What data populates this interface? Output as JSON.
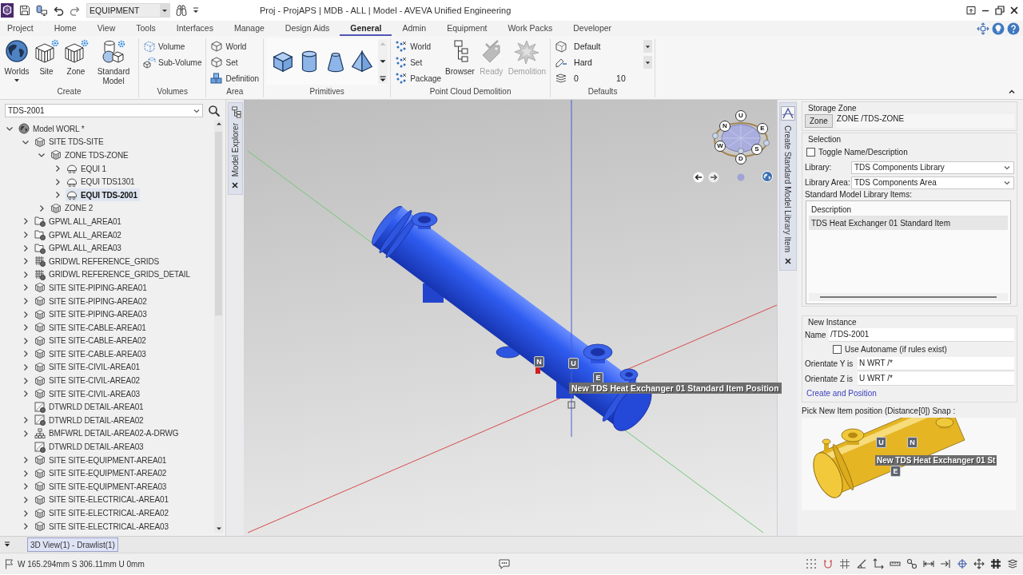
{
  "title_bar": {
    "quick_access_value": "EQUIPMENT",
    "title": "Proj - ProjAPS | MDB - ALL | Model - AVEVA Unified Engineering"
  },
  "ribbon": {
    "tabs": [
      {
        "label": "Project",
        "selected": false
      },
      {
        "label": "Home",
        "selected": false
      },
      {
        "label": "View",
        "selected": false
      },
      {
        "label": "Tools",
        "selected": false
      },
      {
        "label": "Interfaces",
        "selected": false
      },
      {
        "label": "Manage",
        "selected": false
      },
      {
        "label": "Design Aids",
        "selected": false
      },
      {
        "label": "General",
        "selected": true
      },
      {
        "label": "Admin",
        "selected": false
      },
      {
        "label": "Equipment",
        "selected": false
      },
      {
        "label": "Work Packs",
        "selected": false
      },
      {
        "label": "Developer",
        "selected": false
      }
    ],
    "groups": [
      {
        "label": "Create",
        "kind": "buttons",
        "items": [
          {
            "kind": "large",
            "label": "Worlds",
            "menu": true
          },
          {
            "kind": "large",
            "label": "Site",
            "menu": false
          },
          {
            "kind": "large",
            "label": "Zone",
            "menu": false
          },
          {
            "kind": "large",
            "label": "Standard Model",
            "menu": false
          }
        ]
      },
      {
        "label": "Volumes",
        "kind": "buttons",
        "items": [
          {
            "kind": "small",
            "label": "Volume"
          },
          {
            "kind": "small",
            "label": "Sub-Volume"
          }
        ]
      },
      {
        "label": "Area",
        "kind": "buttons",
        "items": [
          {
            "kind": "small",
            "label": "World"
          },
          {
            "kind": "small",
            "label": "Set"
          },
          {
            "kind": "small",
            "label": "Definition"
          }
        ]
      },
      {
        "label": "Primitives",
        "kind": "gallery"
      },
      {
        "label": "Point Cloud Demolition",
        "kind": "buttons",
        "items": [
          {
            "kind": "small",
            "label": "World",
            "disabled": false
          },
          {
            "kind": "small",
            "label": "Set",
            "disabled": false
          },
          {
            "kind": "small",
            "label": "Package",
            "disabled": false
          },
          {
            "kind": "large",
            "label": "Browser",
            "disabled": false
          },
          {
            "kind": "large",
            "label": "Ready",
            "disabled": true
          },
          {
            "kind": "large",
            "label": "Demolition",
            "disabled": true
          }
        ]
      },
      {
        "label": "Defaults",
        "kind": "defaults",
        "dropdowns": [
          "Default",
          "Hard"
        ],
        "range": [
          "0",
          "10"
        ]
      }
    ]
  },
  "model_explorer": {
    "search_value": "TDS-2001",
    "tab_label": "Model Explorer",
    "tree": [
      {
        "label": "Model WORL *",
        "kind": "world",
        "expandable": true,
        "expanded": true,
        "selected": false,
        "children": [
          {
            "label": "SITE TDS-SITE",
            "kind": "site",
            "expandable": true,
            "expanded": true,
            "selected": false,
            "children": [
              {
                "label": "ZONE TDS-ZONE",
                "kind": "zone",
                "expandable": true,
                "expanded": true,
                "selected": false,
                "children": [
                  {
                    "label": "EQUI 1",
                    "kind": "equi",
                    "expandable": true,
                    "expanded": false,
                    "selected": false
                  },
                  {
                    "label": "EQUI TDS1301",
                    "kind": "equi",
                    "expandable": true,
                    "expanded": false,
                    "selected": false
                  },
                  {
                    "label": "EQUI TDS-2001",
                    "kind": "equi",
                    "expandable": true,
                    "expanded": false,
                    "selected": true
                  }
                ]
              },
              {
                "label": "ZONE 2",
                "kind": "zone",
                "expandable": true,
                "expanded": false,
                "selected": false
              }
            ]
          },
          {
            "label": "GPWL ALL_AREA01",
            "kind": "gpwl",
            "expandable": true,
            "expanded": false,
            "selected": false
          },
          {
            "label": "GPWL ALL_AREA02",
            "kind": "gpwl",
            "expandable": true,
            "expanded": false,
            "selected": false
          },
          {
            "label": "GPWL ALL_AREA03",
            "kind": "gpwl",
            "expandable": true,
            "expanded": false,
            "selected": false
          },
          {
            "label": "GRIDWL REFERENCE_GRIDS",
            "kind": "gridwl",
            "expandable": true,
            "expanded": false,
            "selected": false
          },
          {
            "label": "GRIDWL REFERENCE_GRIDS_DETAIL",
            "kind": "gridwl",
            "expandable": true,
            "expanded": false,
            "selected": false
          },
          {
            "label": "SITE SITE-PIPING-AREA01",
            "kind": "site",
            "expandable": true,
            "expanded": false,
            "selected": false
          },
          {
            "label": "SITE SITE-PIPING-AREA02",
            "kind": "site",
            "expandable": true,
            "expanded": false,
            "selected": false
          },
          {
            "label": "SITE SITE-PIPING-AREA03",
            "kind": "site",
            "expandable": true,
            "expanded": false,
            "selected": false
          },
          {
            "label": "SITE SITE-CABLE-AREA01",
            "kind": "site",
            "expandable": true,
            "expanded": false,
            "selected": false
          },
          {
            "label": "SITE SITE-CABLE-AREA02",
            "kind": "site",
            "expandable": true,
            "expanded": false,
            "selected": false
          },
          {
            "label": "SITE SITE-CABLE-AREA03",
            "kind": "site",
            "expandable": true,
            "expanded": false,
            "selected": false
          },
          {
            "label": "SITE SITE-CIVIL-AREA01",
            "kind": "site",
            "expandable": true,
            "expanded": false,
            "selected": false
          },
          {
            "label": "SITE SITE-CIVIL-AREA02",
            "kind": "site",
            "expandable": true,
            "expanded": false,
            "selected": false
          },
          {
            "label": "SITE SITE-CIVIL-AREA03",
            "kind": "site",
            "expandable": true,
            "expanded": false,
            "selected": false
          },
          {
            "label": "DTWRLD DETAIL-AREA01",
            "kind": "dtwrld",
            "expandable": false,
            "selected": false
          },
          {
            "label": "DTWRLD DETAIL-AREA02",
            "kind": "dtwrld",
            "expandable": true,
            "expanded": false,
            "selected": false
          },
          {
            "label": "BMFWRL DETAIL-AREA02-A-DRWG",
            "kind": "bmfwrl",
            "expandable": true,
            "expanded": false,
            "selected": false
          },
          {
            "label": "DTWRLD DETAIL-AREA03",
            "kind": "dtwrld",
            "expandable": false,
            "selected": false
          },
          {
            "label": "SITE SITE-EQUIPMENT-AREA01",
            "kind": "site",
            "expandable": true,
            "expanded": false,
            "selected": false
          },
          {
            "label": "SITE SITE-EQUIPMENT-AREA02",
            "kind": "site",
            "expandable": true,
            "expanded": false,
            "selected": false
          },
          {
            "label": "SITE SITE-EQUIPMENT-AREA03",
            "kind": "site",
            "expandable": true,
            "expanded": false,
            "selected": false
          },
          {
            "label": "SITE SITE-ELECTRICAL-AREA01",
            "kind": "site",
            "expandable": true,
            "expanded": false,
            "selected": false
          },
          {
            "label": "SITE SITE-ELECTRICAL-AREA02",
            "kind": "site",
            "expandable": true,
            "expanded": false,
            "selected": false
          },
          {
            "label": "SITE SITE-ELECTRICAL-AREA03",
            "kind": "site",
            "expandable": true,
            "expanded": false,
            "selected": false
          }
        ]
      }
    ]
  },
  "viewport": {
    "view_cube_labels": [
      "U",
      "N",
      "E",
      "W",
      "S",
      "D"
    ],
    "markers": [
      "N",
      "U",
      "E"
    ],
    "tooltip": "New TDS Heat Exchanger 01 Standard Item Position"
  },
  "library_panel": {
    "tab_label": "Create Standard Model Library Item",
    "storage_zone": {
      "title": "Storage Zone",
      "button": "Zone",
      "value": "ZONE /TDS-ZONE"
    },
    "selection": {
      "title": "Selection",
      "toggle": {
        "label": "Toggle Name/Description",
        "checked": false
      },
      "library": {
        "label": "Library:",
        "value": "TDS Components Library"
      },
      "library_area": {
        "label": "Library Area:",
        "value": "TDS Components Area"
      },
      "items_label": "Standard Model Library Items:",
      "items_column": "Description",
      "items": [
        {
          "label": "TDS Heat Exchanger 01 Standard Item",
          "selected": true
        }
      ]
    },
    "new_instance": {
      "title": "New Instance",
      "name_label": "Name",
      "name_value": "/TDS-2001",
      "autoname": {
        "label": "Use Autoname (if rules exist)",
        "checked": false
      },
      "orient_y": {
        "label": "Orientate Y is",
        "value": "N WRT /*"
      },
      "orient_z": {
        "label": "Orientate Z is",
        "value": "U WRT /*"
      },
      "link": "Create and Position"
    },
    "pick_prompt": "Pick New Item position (Distance[0]) Snap :",
    "preview": {
      "markers": [
        "U",
        "N",
        "E"
      ],
      "tooltip": "New TDS Heat Exchanger 01 St"
    }
  },
  "document_tabs": [
    {
      "label": "3D View(1) - Drawlist(1)",
      "selected": true
    }
  ],
  "status_bar": {
    "coordinates": "W 165.294mm S 306.11mm U 0mm"
  }
}
